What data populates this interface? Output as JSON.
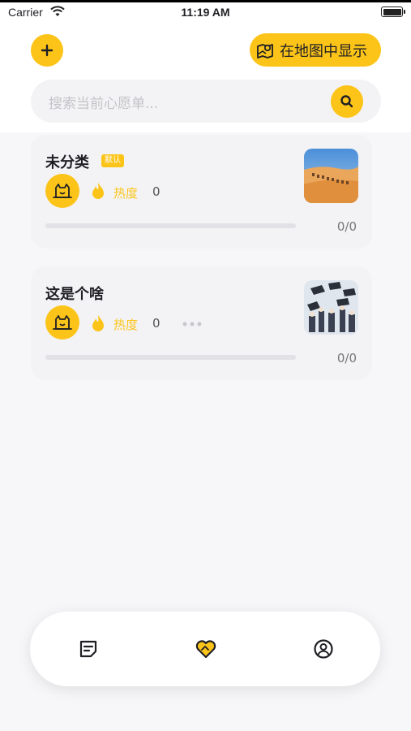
{
  "status_bar": {
    "carrier": "Carrier",
    "time": "11:19 AM"
  },
  "header": {
    "map_button_label": "在地图中显示",
    "search_placeholder": "搜索当前心愿单..."
  },
  "colors": {
    "accent": "#fcc419",
    "card_bg": "#f3f3f5",
    "text": "#1f1f24"
  },
  "lists": [
    {
      "title": "未分类",
      "tag": "默认",
      "heat_label": "热度",
      "heat_value": "0",
      "progress_text": "0/0",
      "progress_fraction": 0,
      "thumbnail": "desert-camels"
    },
    {
      "title": "这是个啥",
      "heat_label": "热度",
      "heat_value": "0",
      "progress_text": "0/0",
      "progress_fraction": 0,
      "thumbnail": "graduation-caps"
    }
  ],
  "tabbar": {
    "items": [
      {
        "icon": "list-icon"
      },
      {
        "icon": "heart-icon",
        "active": true
      },
      {
        "icon": "profile-icon"
      }
    ]
  }
}
